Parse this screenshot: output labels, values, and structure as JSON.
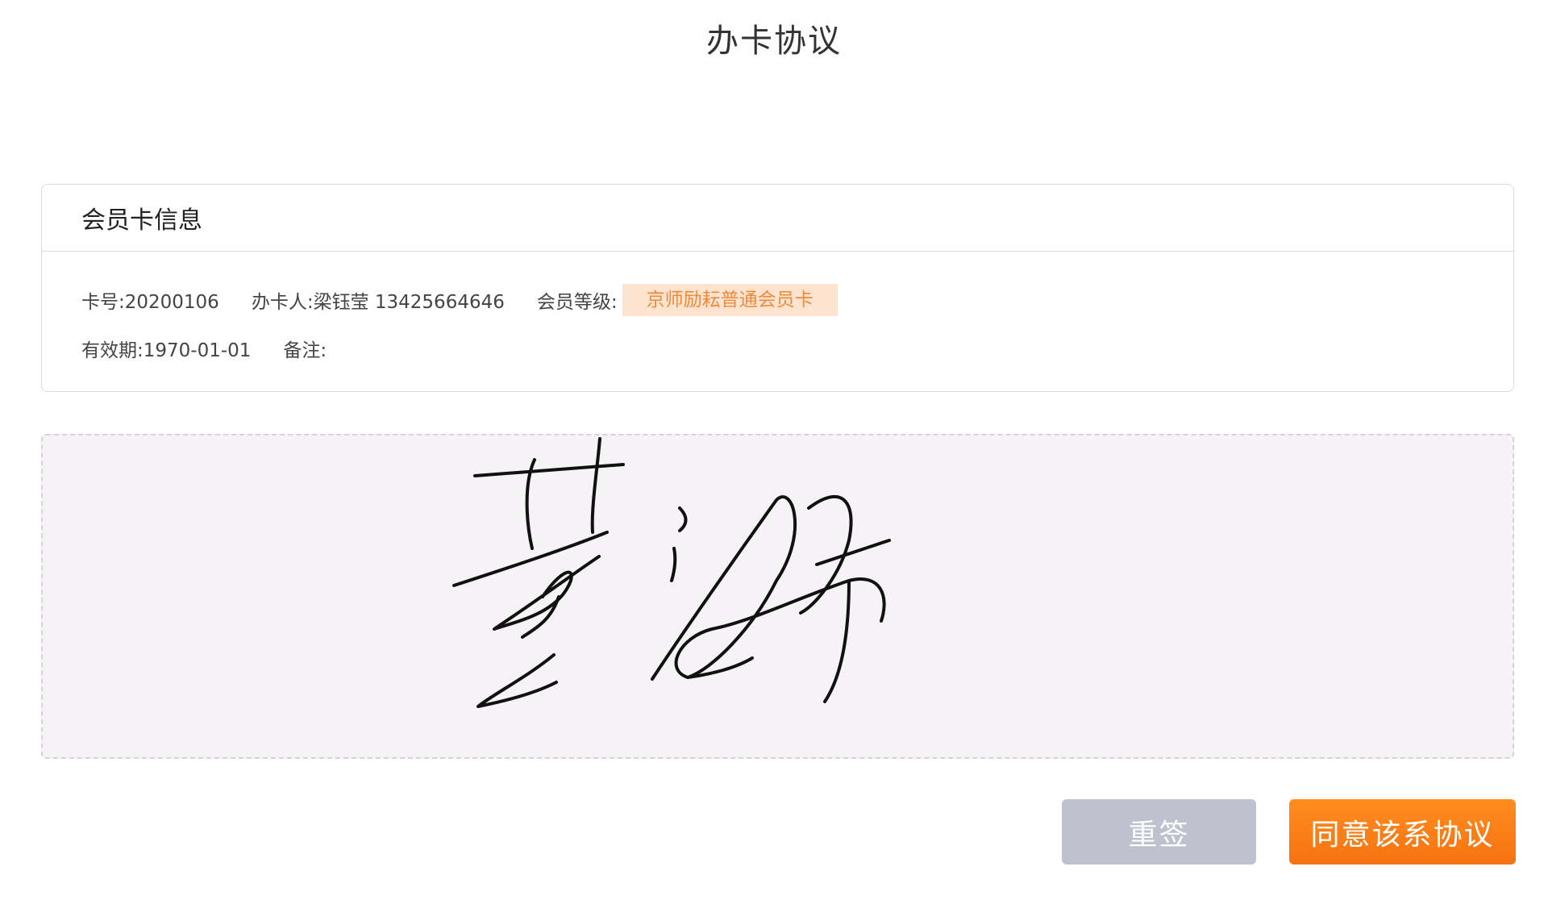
{
  "header": {
    "title": "办卡协议"
  },
  "card": {
    "title": "会员卡信息",
    "card_number": "卡号:20200106",
    "applicant": "办卡人:梁钰莹 13425664646",
    "level_label": "会员等级:",
    "level_value": "京师励耘普通会员卡",
    "validity": "有效期:1970-01-01",
    "remark": "备注:"
  },
  "signature": {
    "stroke_color": "#111111",
    "background": "#f6f3f6"
  },
  "actions": {
    "resign_label": "重签",
    "agree_label": "同意该系协议"
  },
  "colors": {
    "accent": "#f67310",
    "badge_bg": "#fde4d0",
    "badge_text": "#ef8a3a",
    "disabled_btn": "#bfc2ce"
  }
}
